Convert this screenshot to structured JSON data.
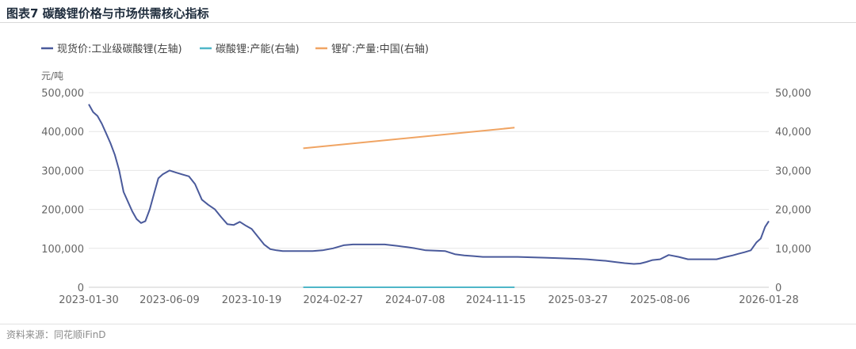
{
  "title": "图表7  碳酸锂价格与市场供需核心指标",
  "source": "资料来源：同花顺iFinD",
  "chart_data": {
    "type": "line",
    "y_left_unit": "元/吨",
    "y_left_lim": [
      0,
      500000
    ],
    "y_left_ticks": [
      "0",
      "100,000",
      "200,000",
      "300,000",
      "400,000",
      "500,000"
    ],
    "y_right_lim": [
      0,
      50000
    ],
    "y_right_ticks": [
      "0",
      "10,000",
      "20,000",
      "30,000",
      "40,000",
      "50,000"
    ],
    "x_ticks": [
      "2023-01-30",
      "2023-06-09",
      "2023-10-19",
      "2024-02-27",
      "2024-07-08",
      "2024-11-15",
      "2025-03-27",
      "2025-08-06",
      "2026-01-28"
    ],
    "x_lim": [
      "2023-01-30",
      "2026-01-28"
    ],
    "grid": true,
    "legend_position": "top-left",
    "series": [
      {
        "name": "现货价:工业级碳酸锂(左轴)",
        "axis": "left",
        "color": "#4a5a9b",
        "x": [
          "2023-01-30",
          "2023-02-06",
          "2023-02-13",
          "2023-02-20",
          "2023-02-27",
          "2023-03-06",
          "2023-03-13",
          "2023-03-20",
          "2023-03-27",
          "2023-04-03",
          "2023-04-10",
          "2023-04-17",
          "2023-04-24",
          "2023-05-01",
          "2023-05-08",
          "2023-05-15",
          "2023-05-22",
          "2023-05-29",
          "2023-06-09",
          "2023-06-19",
          "2023-06-29",
          "2023-07-10",
          "2023-07-20",
          "2023-07-31",
          "2023-08-10",
          "2023-08-21",
          "2023-08-31",
          "2023-09-10",
          "2023-09-20",
          "2023-09-30",
          "2023-10-10",
          "2023-10-19",
          "2023-10-29",
          "2023-11-08",
          "2023-11-18",
          "2023-11-28",
          "2023-12-08",
          "2023-12-18",
          "2023-12-28",
          "2024-01-10",
          "2024-01-25",
          "2024-02-10",
          "2024-02-27",
          "2024-03-15",
          "2024-03-30",
          "2024-04-15",
          "2024-05-01",
          "2024-05-20",
          "2024-06-10",
          "2024-06-25",
          "2024-07-08",
          "2024-07-25",
          "2024-08-10",
          "2024-08-25",
          "2024-09-10",
          "2024-09-25",
          "2024-10-10",
          "2024-10-25",
          "2024-11-15",
          "2024-12-01",
          "2024-12-20",
          "2025-01-10",
          "2025-02-01",
          "2025-02-20",
          "2025-03-10",
          "2025-03-27",
          "2025-04-10",
          "2025-04-25",
          "2025-05-10",
          "2025-05-25",
          "2025-06-10",
          "2025-06-25",
          "2025-07-05",
          "2025-07-15",
          "2025-07-25",
          "2025-08-06",
          "2025-08-20",
          "2025-09-05",
          "2025-09-20",
          "2025-10-05",
          "2025-10-20",
          "2025-11-05",
          "2025-11-20",
          "2025-12-01",
          "2025-12-10",
          "2025-12-20",
          "2025-12-30",
          "2026-01-08",
          "2026-01-15",
          "2026-01-22",
          "2026-01-28"
        ],
        "values": [
          470000,
          450000,
          440000,
          420000,
          395000,
          370000,
          340000,
          300000,
          245000,
          220000,
          195000,
          175000,
          165000,
          170000,
          200000,
          240000,
          280000,
          290000,
          300000,
          295000,
          290000,
          285000,
          265000,
          225000,
          212000,
          200000,
          180000,
          162000,
          160000,
          168000,
          158000,
          150000,
          130000,
          110000,
          98000,
          95000,
          93000,
          93000,
          93000,
          93000,
          93000,
          95000,
          100000,
          108000,
          110000,
          110000,
          110000,
          110000,
          106000,
          103000,
          100000,
          95000,
          94000,
          93000,
          85000,
          82000,
          80000,
          78000,
          78000,
          78000,
          78000,
          77000,
          76000,
          75000,
          74000,
          73000,
          72000,
          70000,
          68000,
          65000,
          62000,
          60000,
          61000,
          65000,
          70000,
          72000,
          83000,
          78000,
          72000,
          72000,
          72000,
          72000,
          78000,
          82000,
          86000,
          90000,
          95000,
          115000,
          125000,
          155000,
          170000
        ]
      },
      {
        "name": "碳酸锂:产能(右轴)",
        "axis": "right",
        "color": "#4fb6c8",
        "x": [
          "2024-01-10",
          "2024-12-15"
        ],
        "values": [
          0,
          0
        ]
      },
      {
        "name": "锂矿:产量:中国(右轴)",
        "axis": "right",
        "color": "#f0a463",
        "x": [
          "2024-01-10",
          "2024-12-15"
        ],
        "values": [
          35700,
          41000
        ]
      }
    ]
  }
}
